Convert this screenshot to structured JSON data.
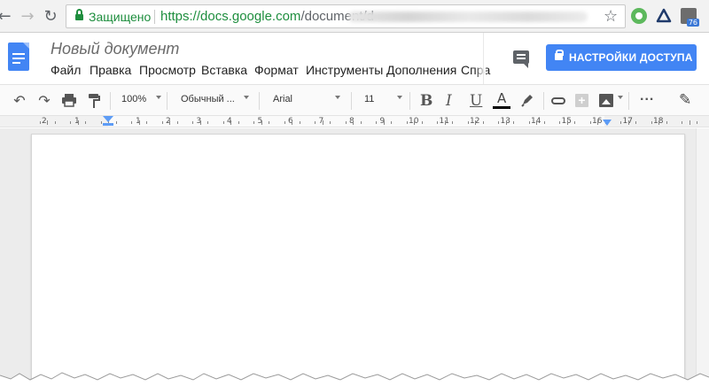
{
  "browser": {
    "nav": {
      "back_icon": "back-arrow-icon",
      "forward_icon": "forward-arrow-icon",
      "reload_icon": "reload-icon"
    },
    "omnibox": {
      "secure_label": "Защищено",
      "url_main": "https://docs.google.com",
      "url_path": "/document/d"
    },
    "bookmark_icon": "star-icon"
  },
  "docs": {
    "title": "Новый документ",
    "menu": [
      "Файл",
      "Правка",
      "Просмотр",
      "Вставка",
      "Формат",
      "Инструменты",
      "Дополнения",
      "Спра"
    ],
    "share_button": "НАСТРОЙКИ ДОСТУПА",
    "toolbar": {
      "zoom": "100%",
      "style": "Обычный ...",
      "font": "Arial",
      "size": "11",
      "bold": "B",
      "italic": "I",
      "underline": "U",
      "text_color_letter": "A",
      "text_color": "#000000",
      "more": "..."
    },
    "ruler": {
      "left_marks": [
        "2",
        "1",
        "1"
      ],
      "marks": [
        "2",
        "3",
        "4",
        "5",
        "6",
        "7",
        "8",
        "9",
        "10",
        "11",
        "12",
        "13",
        "14",
        "15"
      ],
      "right_marks": [
        "16",
        "17",
        "18"
      ]
    }
  },
  "colors": {
    "accent": "#4285f4",
    "secure": "#1e8e3e"
  }
}
